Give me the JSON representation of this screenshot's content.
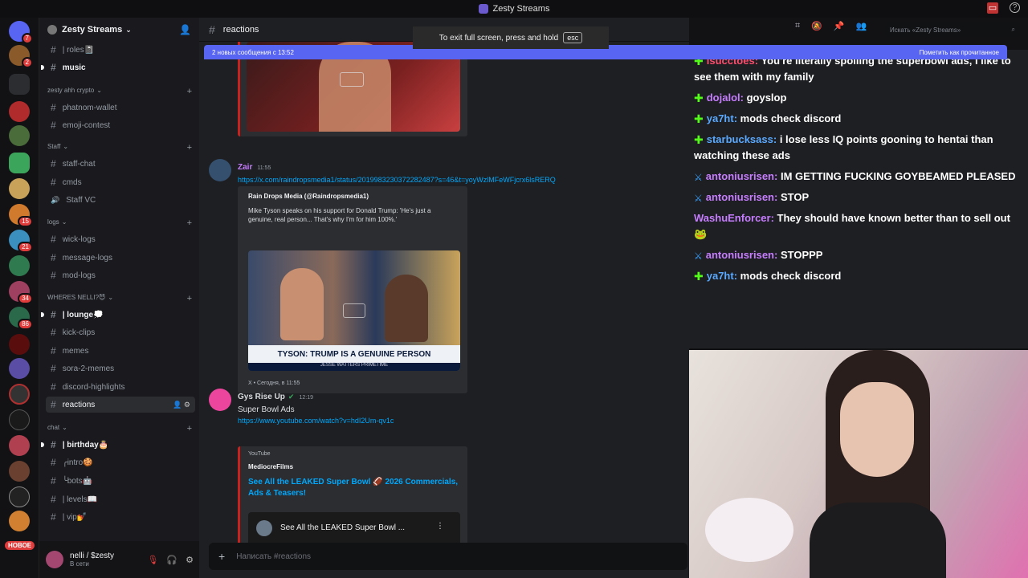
{
  "window": {
    "title": "Zesty Streams"
  },
  "servers": {
    "badges": [
      "7",
      "2",
      "15",
      "21",
      "34",
      "86"
    ],
    "new_label": "НОВОЕ"
  },
  "guild": {
    "name": "Zesty Streams"
  },
  "channels": [
    {
      "label": "| roles📓",
      "type": "text",
      "state": "normal"
    },
    {
      "label": "music",
      "type": "text",
      "state": "bold"
    },
    {
      "label": "zesty ahh crypto",
      "type": "category"
    },
    {
      "label": "phatnom-wallet",
      "type": "text",
      "state": "normal"
    },
    {
      "label": "emoji-contest",
      "type": "text",
      "state": "normal"
    },
    {
      "label": "Staff",
      "type": "category"
    },
    {
      "label": "staff-chat",
      "type": "text",
      "state": "normal"
    },
    {
      "label": "cmds",
      "type": "text",
      "state": "normal"
    },
    {
      "label": "Staff VC",
      "type": "voice",
      "state": "normal"
    },
    {
      "label": "logs",
      "type": "category"
    },
    {
      "label": "wick-logs",
      "type": "text",
      "state": "normal"
    },
    {
      "label": "message-logs",
      "type": "text",
      "state": "normal"
    },
    {
      "label": "mod-logs",
      "type": "text",
      "state": "normal"
    },
    {
      "label": "WHERES NELLI?😈",
      "type": "category"
    },
    {
      "label": "| lounge💭",
      "type": "text",
      "state": "bold"
    },
    {
      "label": "kick-clips",
      "type": "text",
      "state": "normal"
    },
    {
      "label": "memes",
      "type": "text",
      "state": "normal"
    },
    {
      "label": "sora-2-memes",
      "type": "text",
      "state": "normal"
    },
    {
      "label": "discord-highlights",
      "type": "text",
      "state": "normal"
    },
    {
      "label": "reactions",
      "type": "text",
      "state": "active"
    },
    {
      "label": "chat",
      "type": "category"
    },
    {
      "label": "| birthday🎂",
      "type": "text",
      "state": "bold"
    },
    {
      "label": "╭intro🍪",
      "type": "text",
      "state": "normal"
    },
    {
      "label": "╰bots🤖",
      "type": "text",
      "state": "normal"
    },
    {
      "label": "| levels📖",
      "type": "text",
      "state": "normal"
    },
    {
      "label": "| vip💅",
      "type": "text",
      "state": "normal"
    }
  ],
  "user": {
    "name": "nelli / $zesty",
    "status": "В сети"
  },
  "channel_header": {
    "name": "reactions"
  },
  "new_messages_bar": {
    "text": "2 новых сообщения с 13:52",
    "mark_read": "Пометить как прочитанное"
  },
  "fullscreen_toast": {
    "text": "To exit full screen, press and hold",
    "key": "esc"
  },
  "search": {
    "placeholder": "Искать «Zesty Streams»"
  },
  "messages": [
    {
      "author": "Zair",
      "author_color": "#c77dff",
      "time": "11:55",
      "link": "https://x.com/raindropsmedia1/status/2019983230372282487?s=46&t=yoyWzlMFeWFjcrx6lsRERQ",
      "embed": {
        "author": "Rain Drops Media (@Raindropsmedia1)",
        "description": "Mike Tyson speaks on his support for Donald Trump: 'He's just a genuine, real person... That's why I'm for him 100%.'",
        "video_caption": "TYSON: TRUMP IS A GENUINE PERSON",
        "video_subcaption": "JESSE WATTERS PRIMETIME",
        "footer": "X • Сегодня, в 11:55"
      }
    },
    {
      "author": "Gys Rise Up",
      "author_color": "#dbdee1",
      "time": "12:19",
      "text": "Super Bowl Ads",
      "link": "https://www.youtube.com/watch?v=hdI2Um-qv1c",
      "embed": {
        "provider": "YouTube",
        "author": "MediocreFilms",
        "title": "See All the LEAKED Super Bowl 🏈 2026 Commercials, Ads & Teasers!",
        "video_title": "See All the LEAKED Super Bowl ..."
      }
    }
  ],
  "composer": {
    "placeholder": "Написать #reactions"
  },
  "live_chat": [
    {
      "badge": "kick",
      "user": "isucctoes:",
      "color": "#ff4d6d",
      "text": "You're literally spoiling the superbowl ads, i like to see them with my family"
    },
    {
      "badge": "kick",
      "user": "dojalol:",
      "color": "#c77dff",
      "text": "goyslop"
    },
    {
      "badge": "kick",
      "user": "ya7ht:",
      "color": "#5aa9ff",
      "text": "mods check discord"
    },
    {
      "badge": "kick",
      "user": "starbucksass:",
      "color": "#5aa9ff",
      "text": "i lose less IQ points gooning to hentai than watching these ads"
    },
    {
      "badge": "sword",
      "user": "antoniusrisen:",
      "color": "#c77dff",
      "text": "IM GETTING FUCKING GOYBEAMED PLEASED"
    },
    {
      "badge": "sword",
      "user": "antoniusrisen:",
      "color": "#c77dff",
      "text": "STOP"
    },
    {
      "badge": "none",
      "user": "WashuEnforcer:",
      "color": "#c77dff",
      "text": "They should have known better than to sell out 🐸"
    },
    {
      "badge": "sword",
      "user": "antoniusrisen:",
      "color": "#c77dff",
      "text": "STOPPP"
    },
    {
      "badge": "kick",
      "user": "ya7ht:",
      "color": "#5aa9ff",
      "text": "mods check discord"
    }
  ],
  "colors": {
    "accent": "#5865f2",
    "kick_green": "#53fc18",
    "link": "#00a8fc",
    "embed_border_red": "#c9211e"
  }
}
